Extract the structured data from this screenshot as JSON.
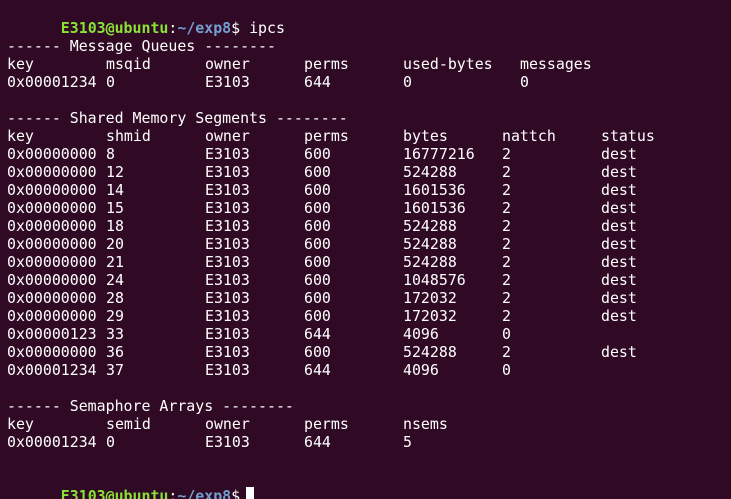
{
  "prompt": {
    "user_host": "E3103@ubuntu",
    "colon": ":",
    "path": "~/exp8",
    "symbol": "$"
  },
  "command": "ipcs",
  "message_queues": {
    "header": "------ Message Queues --------",
    "columns": [
      "key",
      "msqid",
      "owner",
      "perms",
      "used-bytes",
      "messages"
    ],
    "rows": [
      [
        "0x00001234",
        "0",
        "E3103",
        "644",
        "0",
        "0"
      ]
    ]
  },
  "shared_memory": {
    "header": "------ Shared Memory Segments --------",
    "columns": [
      "key",
      "shmid",
      "owner",
      "perms",
      "bytes",
      "nattch",
      "status"
    ],
    "rows": [
      [
        "0x00000000",
        "8",
        "E3103",
        "600",
        "16777216",
        "2",
        "dest"
      ],
      [
        "0x00000000",
        "12",
        "E3103",
        "600",
        "524288",
        "2",
        "dest"
      ],
      [
        "0x00000000",
        "14",
        "E3103",
        "600",
        "1601536",
        "2",
        "dest"
      ],
      [
        "0x00000000",
        "15",
        "E3103",
        "600",
        "1601536",
        "2",
        "dest"
      ],
      [
        "0x00000000",
        "18",
        "E3103",
        "600",
        "524288",
        "2",
        "dest"
      ],
      [
        "0x00000000",
        "20",
        "E3103",
        "600",
        "524288",
        "2",
        "dest"
      ],
      [
        "0x00000000",
        "21",
        "E3103",
        "600",
        "524288",
        "2",
        "dest"
      ],
      [
        "0x00000000",
        "24",
        "E3103",
        "600",
        "1048576",
        "2",
        "dest"
      ],
      [
        "0x00000000",
        "28",
        "E3103",
        "600",
        "172032",
        "2",
        "dest"
      ],
      [
        "0x00000000",
        "29",
        "E3103",
        "600",
        "172032",
        "2",
        "dest"
      ],
      [
        "0x00000123",
        "33",
        "E3103",
        "644",
        "4096",
        "0",
        ""
      ],
      [
        "0x00000000",
        "36",
        "E3103",
        "600",
        "524288",
        "2",
        "dest"
      ],
      [
        "0x00001234",
        "37",
        "E3103",
        "644",
        "4096",
        "0",
        ""
      ]
    ]
  },
  "semaphore_arrays": {
    "header": "------ Semaphore Arrays --------",
    "columns": [
      "key",
      "semid",
      "owner",
      "perms",
      "nsems"
    ],
    "rows": [
      [
        "0x00001234",
        "0",
        "E3103",
        "644",
        "5"
      ]
    ]
  },
  "colors": {
    "background": "#300a24",
    "text": "#ffffff",
    "user_host": "#8ae234",
    "path": "#729fcf"
  }
}
